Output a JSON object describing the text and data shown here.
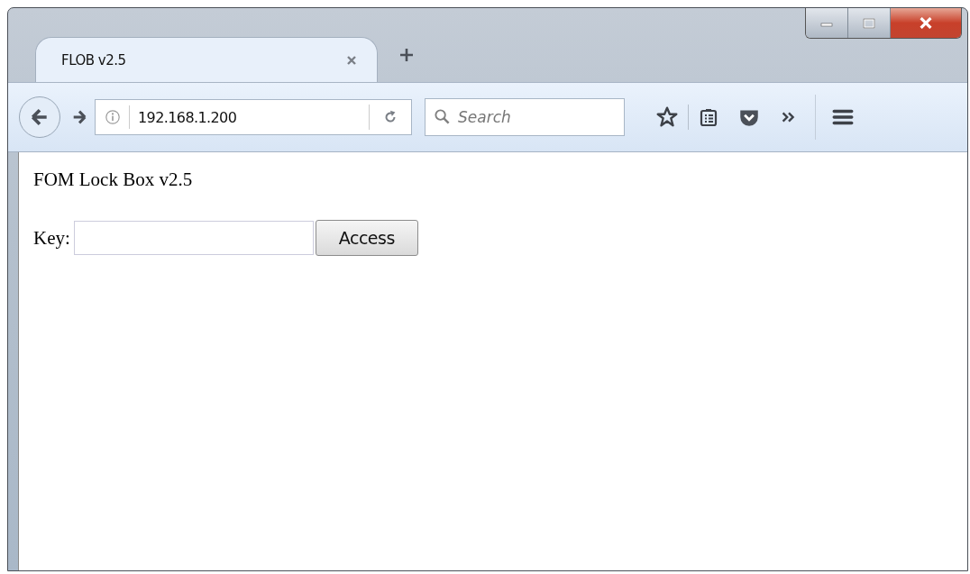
{
  "tabs": [
    {
      "title": "FLOB v2.5",
      "selected": true
    }
  ],
  "address_bar": {
    "url": "192.168.1.200"
  },
  "search": {
    "placeholder": "Search"
  },
  "page": {
    "heading": "FOM Lock Box v2.5",
    "key_label": "Key:",
    "button": "Access"
  }
}
